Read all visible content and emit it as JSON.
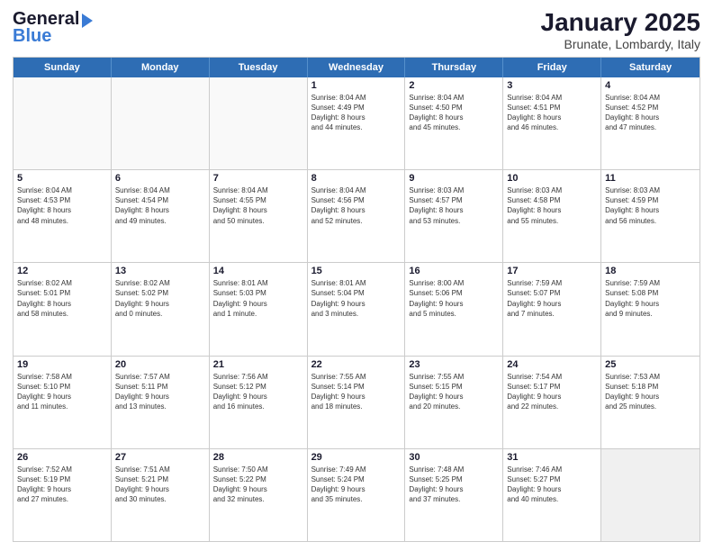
{
  "logo": {
    "line1": "General",
    "line2": "Blue"
  },
  "title": "January 2025",
  "subtitle": "Brunate, Lombardy, Italy",
  "days": [
    "Sunday",
    "Monday",
    "Tuesday",
    "Wednesday",
    "Thursday",
    "Friday",
    "Saturday"
  ],
  "rows": [
    [
      {
        "num": "",
        "text": "",
        "empty": true
      },
      {
        "num": "",
        "text": "",
        "empty": true
      },
      {
        "num": "",
        "text": "",
        "empty": true
      },
      {
        "num": "1",
        "text": "Sunrise: 8:04 AM\nSunset: 4:49 PM\nDaylight: 8 hours\nand 44 minutes."
      },
      {
        "num": "2",
        "text": "Sunrise: 8:04 AM\nSunset: 4:50 PM\nDaylight: 8 hours\nand 45 minutes."
      },
      {
        "num": "3",
        "text": "Sunrise: 8:04 AM\nSunset: 4:51 PM\nDaylight: 8 hours\nand 46 minutes."
      },
      {
        "num": "4",
        "text": "Sunrise: 8:04 AM\nSunset: 4:52 PM\nDaylight: 8 hours\nand 47 minutes."
      }
    ],
    [
      {
        "num": "5",
        "text": "Sunrise: 8:04 AM\nSunset: 4:53 PM\nDaylight: 8 hours\nand 48 minutes."
      },
      {
        "num": "6",
        "text": "Sunrise: 8:04 AM\nSunset: 4:54 PM\nDaylight: 8 hours\nand 49 minutes."
      },
      {
        "num": "7",
        "text": "Sunrise: 8:04 AM\nSunset: 4:55 PM\nDaylight: 8 hours\nand 50 minutes."
      },
      {
        "num": "8",
        "text": "Sunrise: 8:04 AM\nSunset: 4:56 PM\nDaylight: 8 hours\nand 52 minutes."
      },
      {
        "num": "9",
        "text": "Sunrise: 8:03 AM\nSunset: 4:57 PM\nDaylight: 8 hours\nand 53 minutes."
      },
      {
        "num": "10",
        "text": "Sunrise: 8:03 AM\nSunset: 4:58 PM\nDaylight: 8 hours\nand 55 minutes."
      },
      {
        "num": "11",
        "text": "Sunrise: 8:03 AM\nSunset: 4:59 PM\nDaylight: 8 hours\nand 56 minutes."
      }
    ],
    [
      {
        "num": "12",
        "text": "Sunrise: 8:02 AM\nSunset: 5:01 PM\nDaylight: 8 hours\nand 58 minutes."
      },
      {
        "num": "13",
        "text": "Sunrise: 8:02 AM\nSunset: 5:02 PM\nDaylight: 9 hours\nand 0 minutes."
      },
      {
        "num": "14",
        "text": "Sunrise: 8:01 AM\nSunset: 5:03 PM\nDaylight: 9 hours\nand 1 minute."
      },
      {
        "num": "15",
        "text": "Sunrise: 8:01 AM\nSunset: 5:04 PM\nDaylight: 9 hours\nand 3 minutes."
      },
      {
        "num": "16",
        "text": "Sunrise: 8:00 AM\nSunset: 5:06 PM\nDaylight: 9 hours\nand 5 minutes."
      },
      {
        "num": "17",
        "text": "Sunrise: 7:59 AM\nSunset: 5:07 PM\nDaylight: 9 hours\nand 7 minutes."
      },
      {
        "num": "18",
        "text": "Sunrise: 7:59 AM\nSunset: 5:08 PM\nDaylight: 9 hours\nand 9 minutes."
      }
    ],
    [
      {
        "num": "19",
        "text": "Sunrise: 7:58 AM\nSunset: 5:10 PM\nDaylight: 9 hours\nand 11 minutes."
      },
      {
        "num": "20",
        "text": "Sunrise: 7:57 AM\nSunset: 5:11 PM\nDaylight: 9 hours\nand 13 minutes."
      },
      {
        "num": "21",
        "text": "Sunrise: 7:56 AM\nSunset: 5:12 PM\nDaylight: 9 hours\nand 16 minutes."
      },
      {
        "num": "22",
        "text": "Sunrise: 7:55 AM\nSunset: 5:14 PM\nDaylight: 9 hours\nand 18 minutes."
      },
      {
        "num": "23",
        "text": "Sunrise: 7:55 AM\nSunset: 5:15 PM\nDaylight: 9 hours\nand 20 minutes."
      },
      {
        "num": "24",
        "text": "Sunrise: 7:54 AM\nSunset: 5:17 PM\nDaylight: 9 hours\nand 22 minutes."
      },
      {
        "num": "25",
        "text": "Sunrise: 7:53 AM\nSunset: 5:18 PM\nDaylight: 9 hours\nand 25 minutes."
      }
    ],
    [
      {
        "num": "26",
        "text": "Sunrise: 7:52 AM\nSunset: 5:19 PM\nDaylight: 9 hours\nand 27 minutes."
      },
      {
        "num": "27",
        "text": "Sunrise: 7:51 AM\nSunset: 5:21 PM\nDaylight: 9 hours\nand 30 minutes."
      },
      {
        "num": "28",
        "text": "Sunrise: 7:50 AM\nSunset: 5:22 PM\nDaylight: 9 hours\nand 32 minutes."
      },
      {
        "num": "29",
        "text": "Sunrise: 7:49 AM\nSunset: 5:24 PM\nDaylight: 9 hours\nand 35 minutes."
      },
      {
        "num": "30",
        "text": "Sunrise: 7:48 AM\nSunset: 5:25 PM\nDaylight: 9 hours\nand 37 minutes."
      },
      {
        "num": "31",
        "text": "Sunrise: 7:46 AM\nSunset: 5:27 PM\nDaylight: 9 hours\nand 40 minutes."
      },
      {
        "num": "",
        "text": "",
        "empty": true,
        "shaded": true
      }
    ]
  ]
}
